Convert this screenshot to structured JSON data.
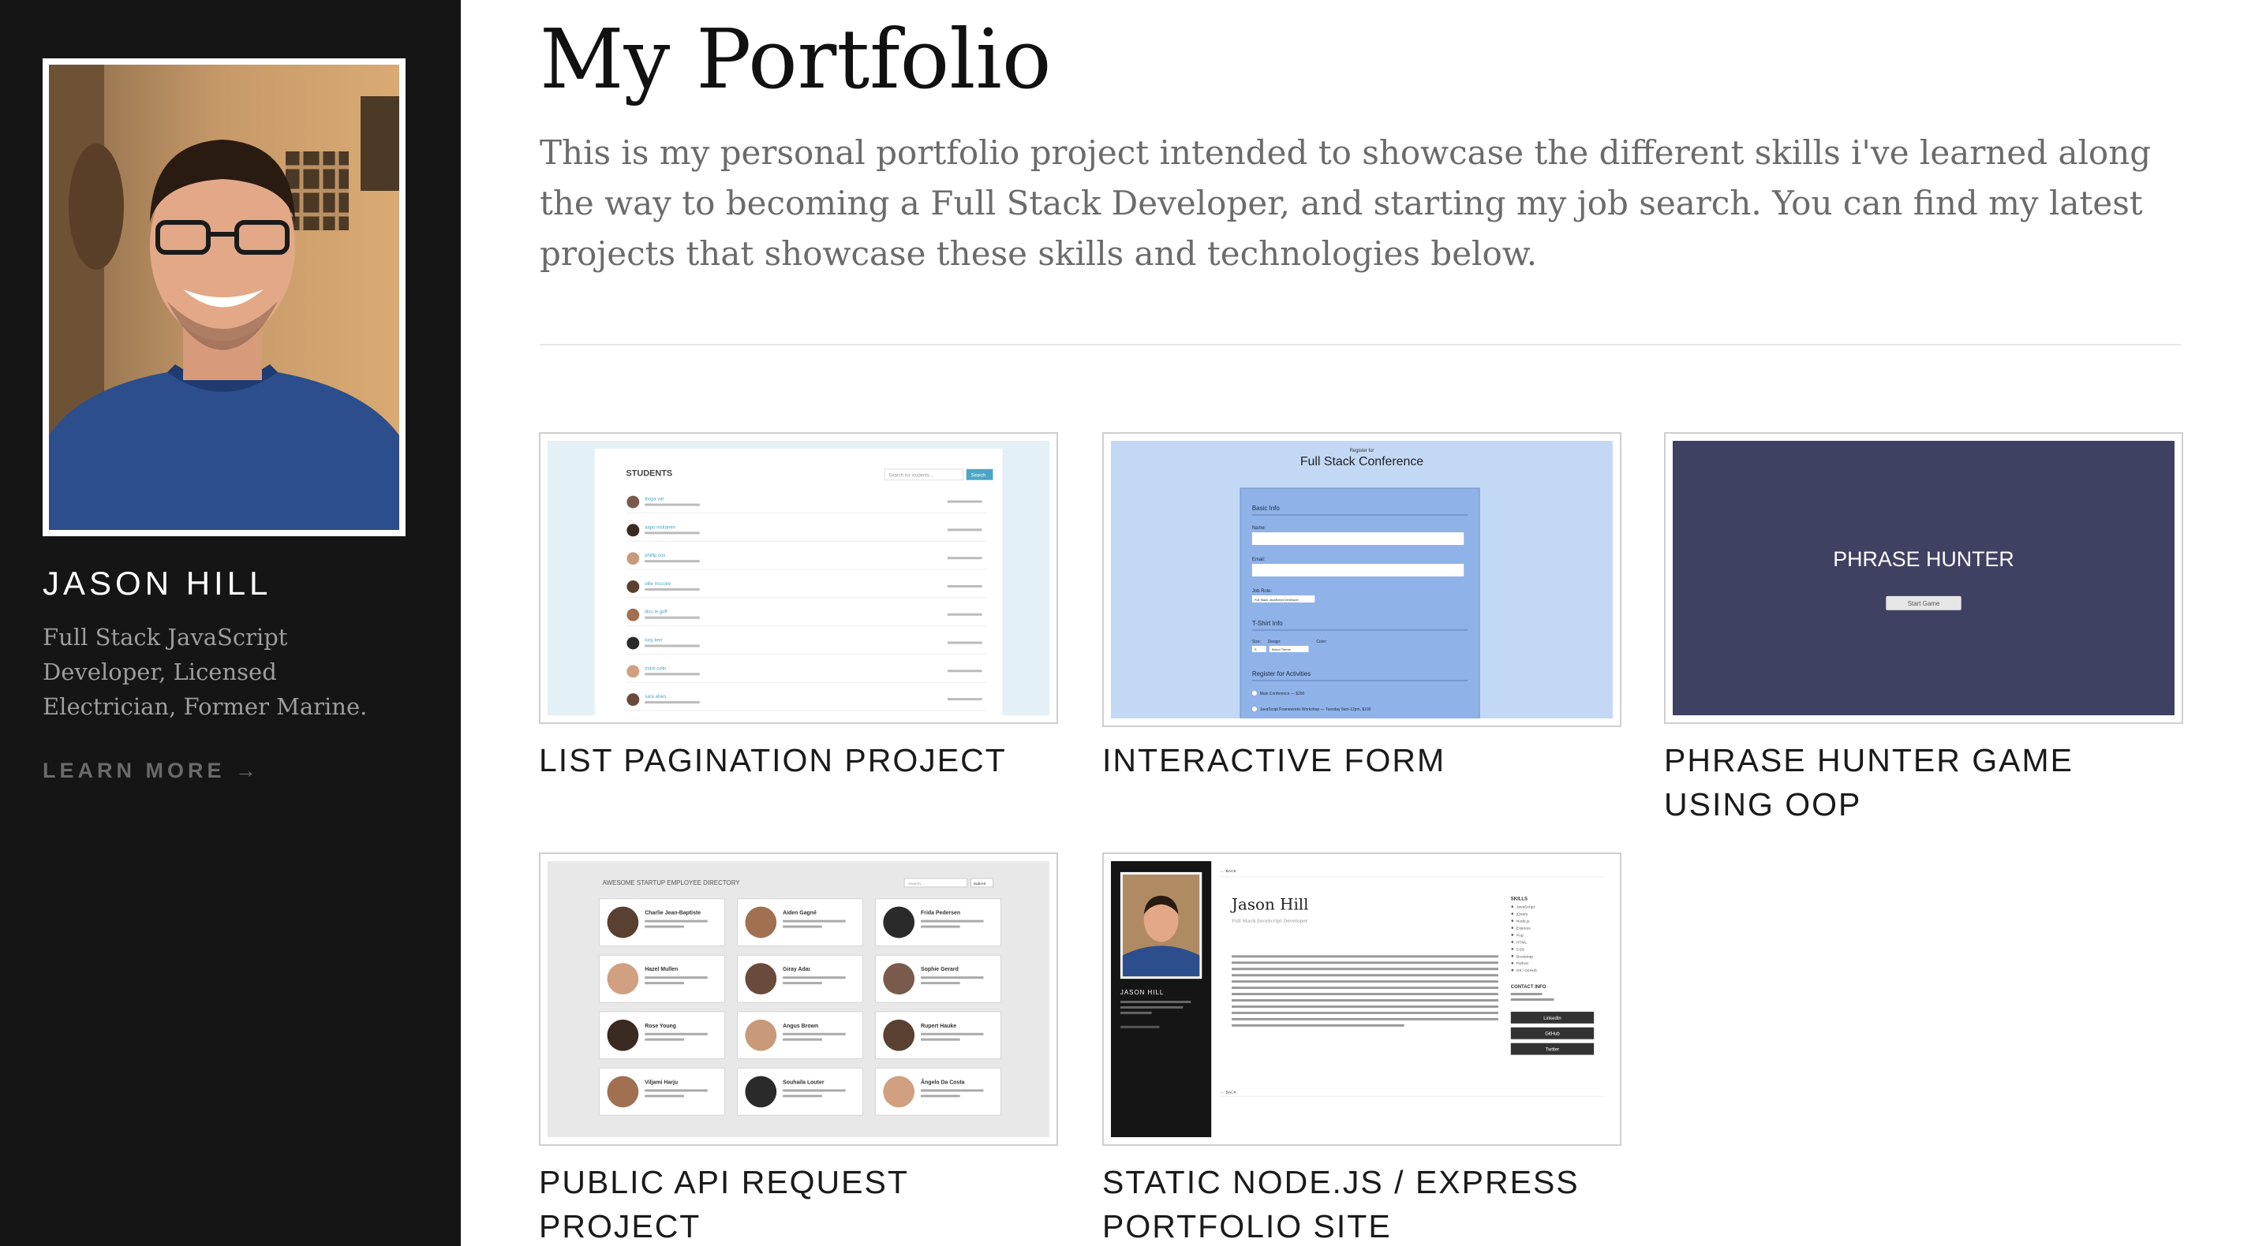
{
  "sidebar": {
    "name": "JASON HILL",
    "tagline": "Full Stack JavaScript Developer, Licensed Electrician, Former Marine.",
    "learn_more": "LEARN MORE →"
  },
  "main": {
    "title": "My Portfolio",
    "intro": "This is my personal portfolio project intended to showcase the different skills i've learned along the way to becoming a Full Stack Developer, and starting my job search. You can find my latest projects that showcase these skills and technologies below."
  },
  "projects": [
    {
      "title": "LIST PAGINATION PROJECT",
      "thumb": {
        "heading": "STUDENTS",
        "search_placeholder": "Search for students...",
        "search_button": "Search",
        "students": [
          "iboya vat",
          "aapo niskanen",
          "phillip cox",
          "ollie mccoire",
          "lilou le goff",
          "lucy kerr",
          "mark colin",
          "sara alves"
        ]
      }
    },
    {
      "title": "INTERACTIVE FORM",
      "thumb": {
        "kicker": "Register for",
        "heading": "Full Stack Conference",
        "section_basic": "Basic Info",
        "label_name": "Name:",
        "label_email": "Email:",
        "label_job": "Job Role:",
        "job_value": "Full Stack JavaScript Developer",
        "section_tshirt": "T-Shirt Info",
        "label_size": "Size:",
        "label_design": "Design:",
        "label_color": "Color:",
        "size_value": "S",
        "design_value": "Select Theme",
        "section_activities": "Register for Activities",
        "activity_1": "Main Conference — $200",
        "activity_2": "JavaScript Frameworks Workshop — Tuesday 9am-12pm, $100"
      }
    },
    {
      "title": "PHRASE HUNTER GAME USING OOP",
      "thumb": {
        "heading": "PHRASE HUNTER",
        "button": "Start Game",
        "bg": "#3f4162"
      }
    },
    {
      "title": "PUBLIC API REQUEST PROJECT",
      "thumb": {
        "heading": "AWESOME STARTUP EMPLOYEE DIRECTORY",
        "search_placeholder": "Search...",
        "submit": "Submit",
        "employees": [
          "Charlie Jean-Baptiste",
          "Aiden Gagné",
          "Frida Pedersen",
          "Hazel Mullen",
          "Giray Adaı",
          "Sophie Gerard",
          "Rose Young",
          "Angus Brown",
          "Rupert Hauke",
          "Viljami Harju",
          "Souhaila Louter",
          "Ângelo Da Costa"
        ]
      }
    },
    {
      "title": "STATIC NODE.JS / EXPRESS PORTFOLIO SITE",
      "thumb": {
        "back": "← BACK",
        "name": "Jason Hill",
        "subtitle": "Full Stack JavaScript Developer",
        "sidebar_name": "JASON HILL",
        "skills_heading": "SKILLS",
        "skills": [
          "JavaScript",
          "jQuery",
          "Node.js",
          "Express",
          "Pug",
          "HTML",
          "CSS",
          "Bootstrap",
          "Python",
          "Git / GitHub"
        ],
        "contact_heading": "CONTACT INFO",
        "buttons": [
          "LinkedIn",
          "GitHub",
          "Twitter"
        ]
      }
    }
  ]
}
